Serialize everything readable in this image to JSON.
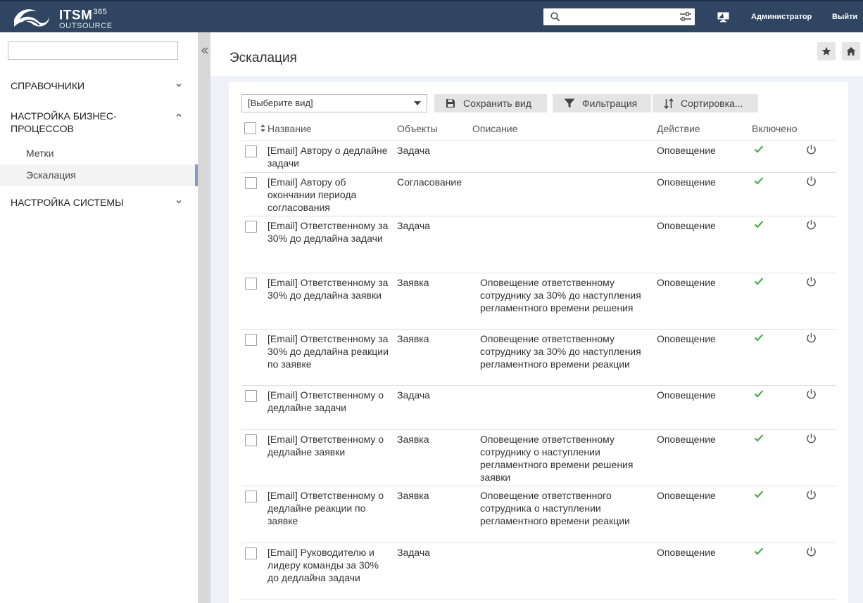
{
  "header": {
    "logo_main": "ITSM",
    "logo_sup": "365",
    "logo_sub": "OUTSOURCE",
    "search_value": "",
    "user_label": "Администратор",
    "logout_label": "Выйти"
  },
  "sidebar": {
    "search_value": "",
    "sections": [
      {
        "label": "СПРАВОЧНИКИ"
      },
      {
        "label": "НАСТРОЙКА БИЗНЕС-ПРОЦЕССОВ"
      },
      {
        "label": "НАСТРОЙКА СИСТЕМЫ"
      }
    ],
    "items": [
      {
        "label": "Метки"
      },
      {
        "label": "Эскалация"
      }
    ]
  },
  "page": {
    "title": "Эскалация"
  },
  "toolbar": {
    "view_select": "[Выберите вид]",
    "save_view": "Сохранить вид",
    "filter": "Фильтрация",
    "sort": "Сортировка..."
  },
  "table": {
    "columns": [
      "Название",
      "Объекты",
      "Описание",
      "Действие",
      "Включено"
    ],
    "rows": [
      {
        "name": "[Email] Автору о дедлайне задачи",
        "object": "Задача",
        "description": "",
        "action": "Оповещение"
      },
      {
        "name": "[Email] Автору об окончании периода согласования",
        "object": "Согласование",
        "description": "",
        "action": "Оповещение"
      },
      {
        "name": "[Email] Ответственному за 30% до дедлайна задачи",
        "object": "Задача",
        "description": "",
        "action": "Оповещение"
      },
      {
        "name": "[Email] Ответственному за 30% до дедлайна заявки",
        "object": "Заявка",
        "description": "Оповещение ответственному сотруднику за 30% до наступления регламентного времени решения",
        "action": "Оповещение"
      },
      {
        "name": "[Email] Ответственному за 30% до дедлайна реакции по заявке",
        "object": "Заявка",
        "description": "Оповещение ответственному сотруднику за 30% до наступления регламентного времени реакции",
        "action": "Оповещение"
      },
      {
        "name": "[Email] Ответственному о дедлайне задачи",
        "object": "Задача",
        "description": "",
        "action": "Оповещение"
      },
      {
        "name": "[Email] Ответственному о дедлайне заявки",
        "object": "Заявка",
        "description": "Оповещение ответственному сотруднику о наступлении регламентного времени решения заявки",
        "action": "Оповещение"
      },
      {
        "name": "[Email] Ответственному о дедлайне реакции по заявке",
        "object": "Заявка",
        "description": "Оповещение ответственного сотрудника о наступлении регламентного времени реакции",
        "action": "Оповещение"
      },
      {
        "name": "[Email] Руководителю и лидеру команды за 30% до дедлайна задачи",
        "object": "Задача",
        "description": "",
        "action": "Оповещение"
      }
    ]
  },
  "colors": {
    "topbar": "#2f4562",
    "enabled_check": "#4caf50",
    "active_marker": "#8a9bb3"
  },
  "icons": [
    "search-icon",
    "filter-settings-icon",
    "monitor-icon",
    "chevron-down-icon",
    "chevron-up-icon",
    "double-chevron-left-icon",
    "star-icon",
    "home-icon",
    "save-icon",
    "funnel-icon",
    "sort-icon",
    "check-icon",
    "power-icon"
  ]
}
